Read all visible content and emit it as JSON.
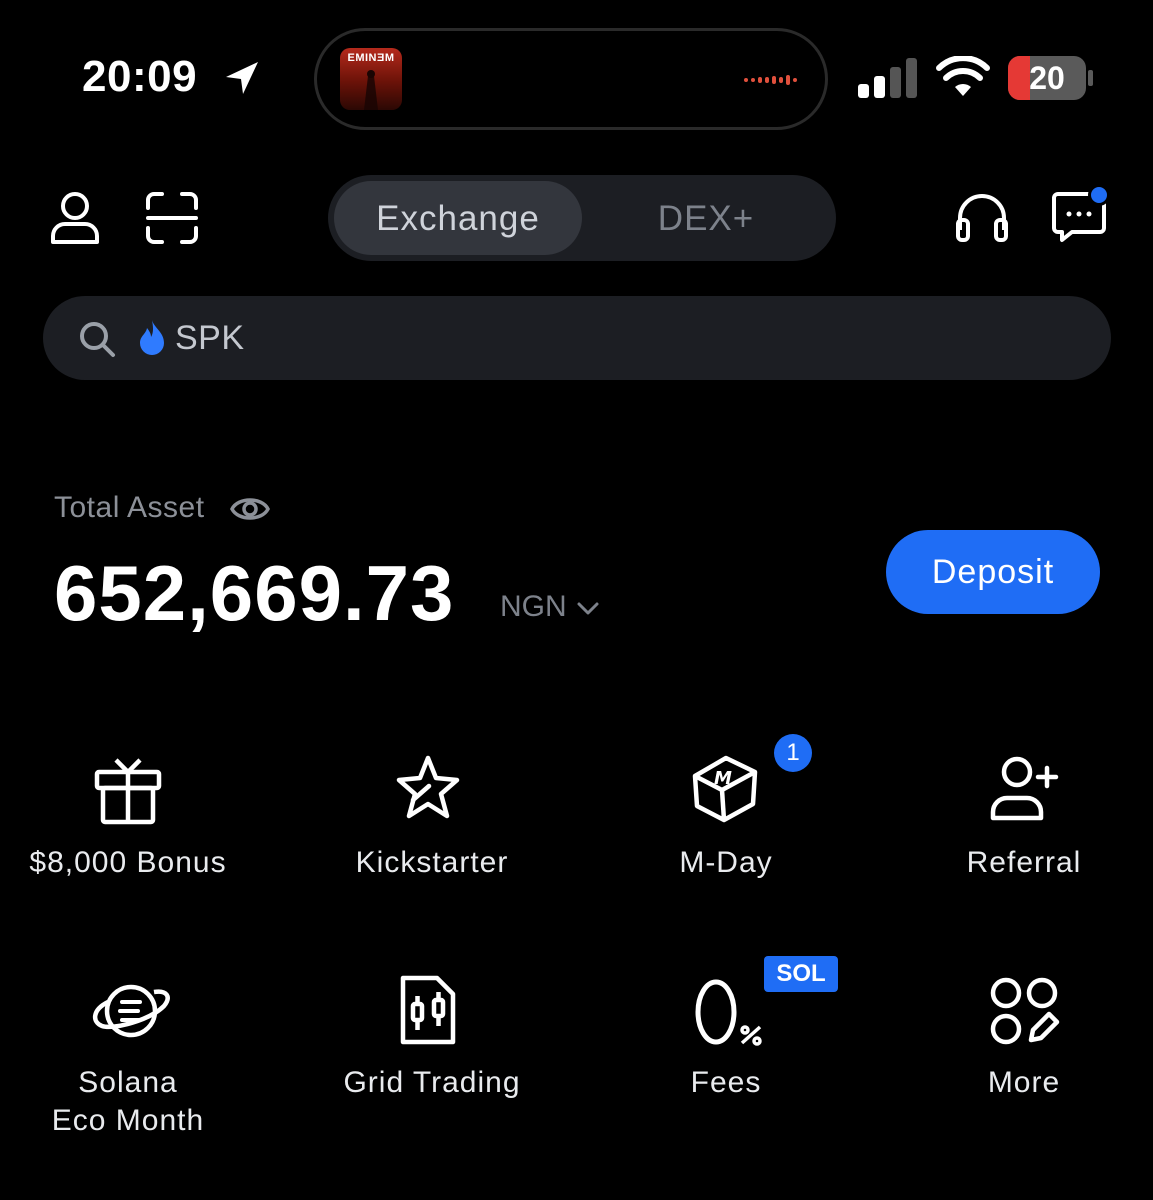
{
  "status_bar": {
    "time": "20:09",
    "battery": "20",
    "now_playing_album_text": "EMINƎM"
  },
  "header": {
    "tabs": [
      {
        "label": "Exchange",
        "active": true
      },
      {
        "label": "DEX+",
        "active": false
      }
    ],
    "has_unread_messages": true
  },
  "search": {
    "text": "SPK"
  },
  "asset": {
    "label": "Total Asset",
    "value": "652,669.73",
    "currency": "NGN",
    "deposit_label": "Deposit"
  },
  "shortcuts": [
    {
      "label": "$8,000 Bonus",
      "icon": "gift-icon"
    },
    {
      "label": "Kickstarter",
      "icon": "star-rocket-icon"
    },
    {
      "label": "M-Day",
      "icon": "m-cube-icon",
      "badge": "1"
    },
    {
      "label": "Referral",
      "icon": "add-person-icon"
    },
    {
      "label_line1": "Solana",
      "label_line2": "Eco Month",
      "icon": "planet-icon"
    },
    {
      "label": "Grid Trading",
      "icon": "grid-trading-icon"
    },
    {
      "label": "Fees",
      "icon": "zero-percent-icon",
      "badge": "SOL"
    },
    {
      "label": "More",
      "icon": "more-apps-icon"
    }
  ],
  "colors": {
    "accent": "#1f6df5",
    "background": "#000000",
    "surface": "#1c1e23",
    "battery_low": "#e53935"
  }
}
